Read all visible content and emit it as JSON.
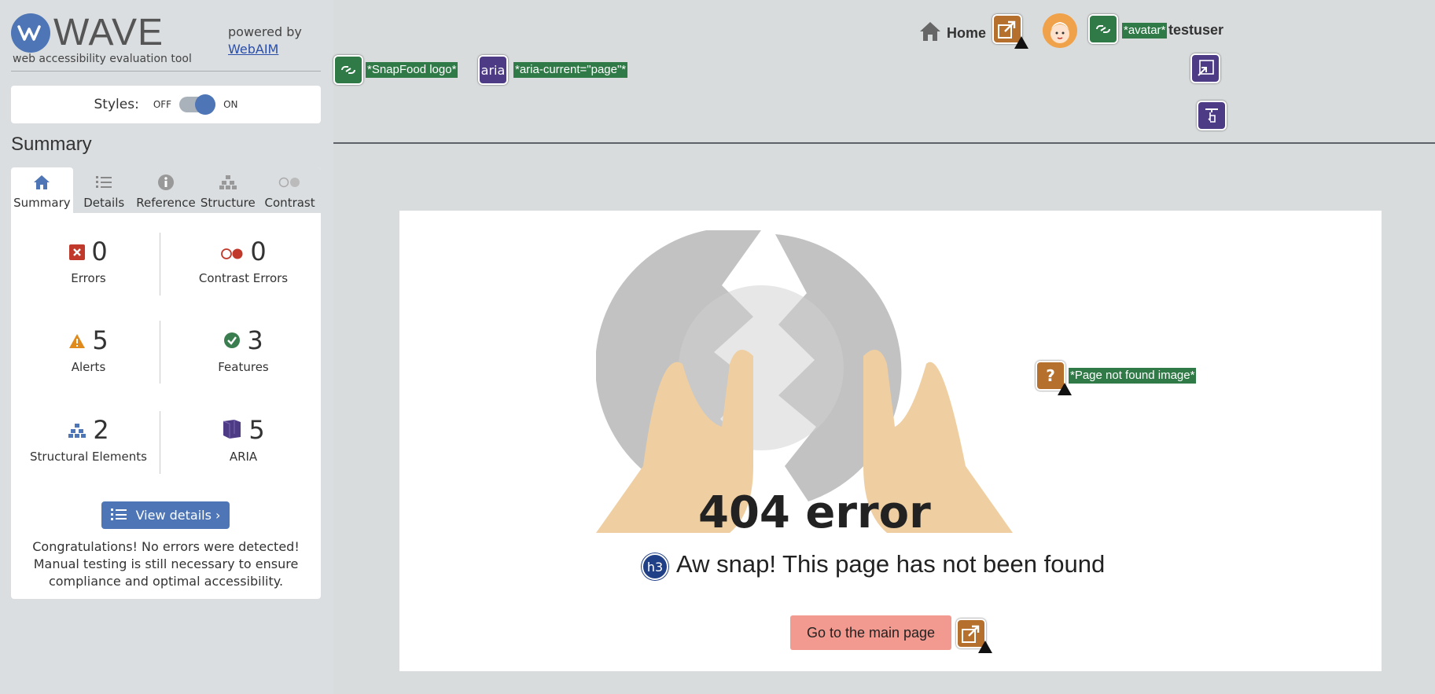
{
  "wave": {
    "logo_text": "WAVE",
    "tagline": "web accessibility evaluation tool",
    "powered_by": "powered by",
    "webaim_link": "WebAIM",
    "styles_label": "Styles:",
    "styles_off": "OFF",
    "styles_on": "ON",
    "styles_state": "on",
    "summary_heading": "Summary",
    "tabs": [
      {
        "label": "Summary",
        "icon": "home-icon",
        "active": true
      },
      {
        "label": "Details",
        "icon": "list-icon",
        "active": false
      },
      {
        "label": "Reference",
        "icon": "info-icon",
        "active": false
      },
      {
        "label": "Structure",
        "icon": "structure-icon",
        "active": false
      },
      {
        "label": "Contrast",
        "icon": "contrast-icon",
        "active": false
      }
    ],
    "stats": {
      "errors": {
        "count": "0",
        "label": "Errors"
      },
      "contrast_errors": {
        "count": "0",
        "label": "Contrast Errors"
      },
      "alerts": {
        "count": "5",
        "label": "Alerts"
      },
      "features": {
        "count": "3",
        "label": "Features"
      },
      "structural": {
        "count": "2",
        "label": "Structural Elements"
      },
      "aria": {
        "count": "5",
        "label": "ARIA"
      }
    },
    "view_details": "View details ›",
    "congrats": "Congratulations! No errors were detected! Manual testing is still necessary to ensure compliance and optimal accessibility."
  },
  "page": {
    "annotations": {
      "snapfood_logo": "*SnapFood logo*",
      "aria_badge": "aria",
      "aria_current": "*aria-current=\"page\"*",
      "avatar": "*avatar*",
      "page_not_found_image": "*Page not found image*"
    },
    "nav": {
      "home": "Home",
      "username": "testuser"
    },
    "error_code": "404 error",
    "h3_badge": "h3",
    "heading": "Aw snap! This page has not been found",
    "main_button": "Go to the main page"
  },
  "colors": {
    "wave_blue": "#4e75b5",
    "error_red": "#c0392b",
    "alert_orange": "#e08a1e",
    "feature_green": "#3a7d4f",
    "aria_purple": "#4e3b85",
    "button_pink": "#f29a8f"
  }
}
